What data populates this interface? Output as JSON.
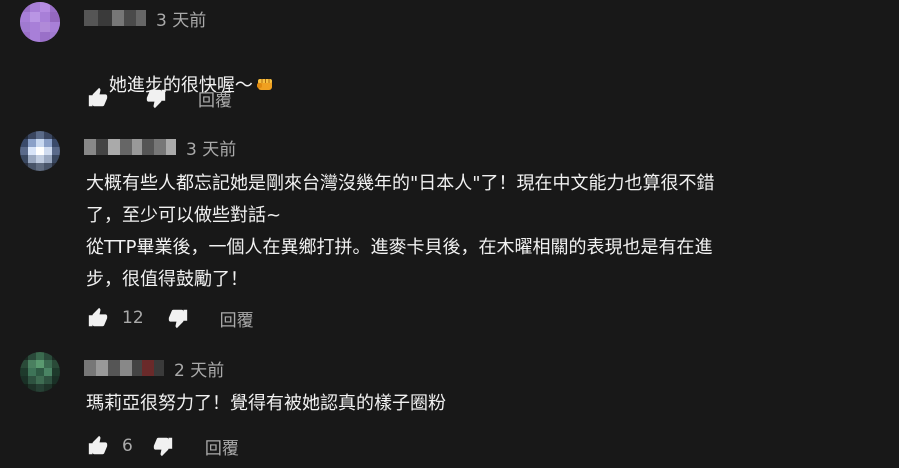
{
  "comments": [
    {
      "timestamp": "3 天前",
      "text": "她進步的很快喔～",
      "emoji": "fist-bump-emoji",
      "likes": "",
      "reply_label": "回覆"
    },
    {
      "timestamp": "3 天前",
      "text": "大概有些人都忘記她是剛來台灣沒幾年的\"日本人\"了！現在中文能力也算很不錯\n了，至少可以做些對話~\n從TTP畢業後，一個人在異鄉打拼。進麥卡貝後，在木曜相關的表現也是有在進\n步，很值得鼓勵了！",
      "likes": "12",
      "reply_label": "回覆"
    },
    {
      "timestamp": "2 天前",
      "text": "瑪莉亞很努力了！覺得有被她認真的樣子圈粉",
      "likes": "6",
      "reply_label": "回覆"
    }
  ],
  "icons": {
    "like": "thumb-up-icon",
    "dislike": "thumb-down-icon"
  },
  "colors": {
    "background": "#181818",
    "text_primary": "#f1f1f1",
    "text_secondary": "#aaaaaa"
  }
}
